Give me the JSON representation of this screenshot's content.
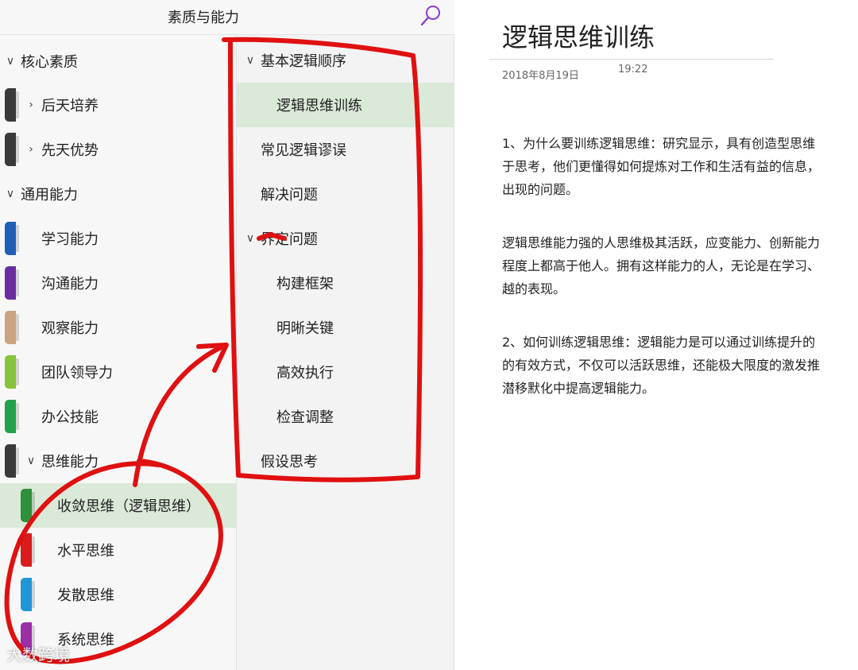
{
  "header": {
    "title": "素质与能力"
  },
  "sections": {
    "group_core": "核心素质",
    "acquired": "后天培养",
    "innate": "先天优势",
    "group_general": "通用能力",
    "learning": "学习能力",
    "communication": "沟通能力",
    "observation": "观察能力",
    "team_leadership": "团队领导力",
    "office_skills": "办公技能",
    "thinking": "思维能力",
    "convergent": "收敛思维（逻辑思维）",
    "lateral": "水平思维",
    "divergent": "发散思维",
    "systemic": "系统思维"
  },
  "pages": {
    "basic_logic_order": "基本逻辑顺序",
    "logic_training": "逻辑思维训练",
    "common_fallacies": "常见逻辑谬误",
    "solve_problems": "解决问题",
    "define_problems": "界定问题",
    "build_framework": "构建框架",
    "clarify_key": "明晰关键",
    "efficient_exec": "高效执行",
    "check_adjust": "检查调整",
    "hypothesis": "假设思考"
  },
  "content": {
    "title": "逻辑思维训练",
    "date": "2018年8月19日",
    "time": "19:22",
    "p1": [
      "1、为什么要训练逻辑思维：研究显示，具有创造型思维",
      "于思考，他们更懂得如何提炼对工作和生活有益的信息，",
      "出现的问题。"
    ],
    "p2": [
      "逻辑思维能力强的人思维极其活跃，应变能力、创新能力",
      "程度上都高于他人。拥有这样能力的人，无论是在学习、",
      "越的表现。"
    ],
    "p3": [
      "2、如何训练逻辑思维：逻辑能力是可以通过训练提升的",
      "的有效方式，不仅可以活跃思维，还能极大限度的激发推",
      "潜移默化中提高逻辑能力。"
    ]
  },
  "watermark": "大数跨境",
  "colors": {
    "tab_acquired": "#3a3a3a",
    "tab_innate": "#3a3a3a",
    "tab_learning": "#1f5fb8",
    "tab_communication": "#6a2ea0",
    "tab_observation": "#c9a47e",
    "tab_team": "#86c23a",
    "tab_office": "#22a34a",
    "tab_thinking": "#3a3a3a",
    "tab_convergent": "#2e8f3c",
    "tab_lateral": "#d81b1b",
    "tab_divergent": "#2196d6",
    "tab_systemic": "#9a2fa6",
    "annotation": "#e01010",
    "search": "#8a3bd1",
    "selected": "#dbe9d8"
  },
  "icons": [
    "search-icon",
    "chevron-down-icon",
    "chevron-right-icon",
    "section-tab-icon"
  ]
}
